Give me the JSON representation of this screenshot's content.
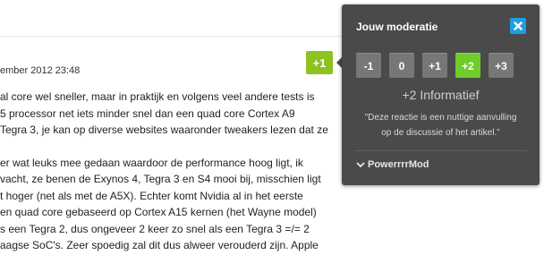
{
  "comment": {
    "timestamp": "ember 2012 23:48",
    "score": "+1",
    "paragraphs": [
      {
        "lines": [
          "al core wel sneller, maar in praktijk en volgens veel andere tests is",
          "5 processor net iets minder snel dan een quad core Cortex A9",
          "Tegra 3, je kan op diverse websites waaronder tweakers lezen dat ze"
        ]
      },
      {
        "lines": [
          "er wat leuks mee gedaan waardoor de performance hoog ligt, ik",
          "vacht, ze benen de Exynos 4, Tegra 3 en S4 mooi bij, misschien ligt",
          "t hoger (net als met de A5X). Echter komt Nvidia al in het eerste",
          "en quad core gebaseerd op Cortex A15 kernen (het Wayne model)",
          "s een Tegra 2, dus ongeveer 2 keer zo snel als een Tegra 3 =/= 2",
          "aagse SoC's. Zeer spoedig zal dit dus alweer verouderd zijn. Apple"
        ]
      }
    ]
  },
  "moderation": {
    "title": "Jouw moderatie",
    "close_icon": "close-icon",
    "options": [
      "-1",
      "0",
      "+1",
      "+2",
      "+3"
    ],
    "selected": "+2",
    "selected_label": "+2 Informatief",
    "description_lines": [
      "\"Deze reactie is een nuttige aanvulling",
      "op de discussie of het artikel.\""
    ],
    "footer_link": "PowerrrrMod",
    "colors": {
      "popup_bg": "#4a4a4a",
      "button": "#777777",
      "selected_button": "#6fcc2a",
      "score_badge": "#8dc21f",
      "close_button": "#1d9fe0"
    }
  }
}
